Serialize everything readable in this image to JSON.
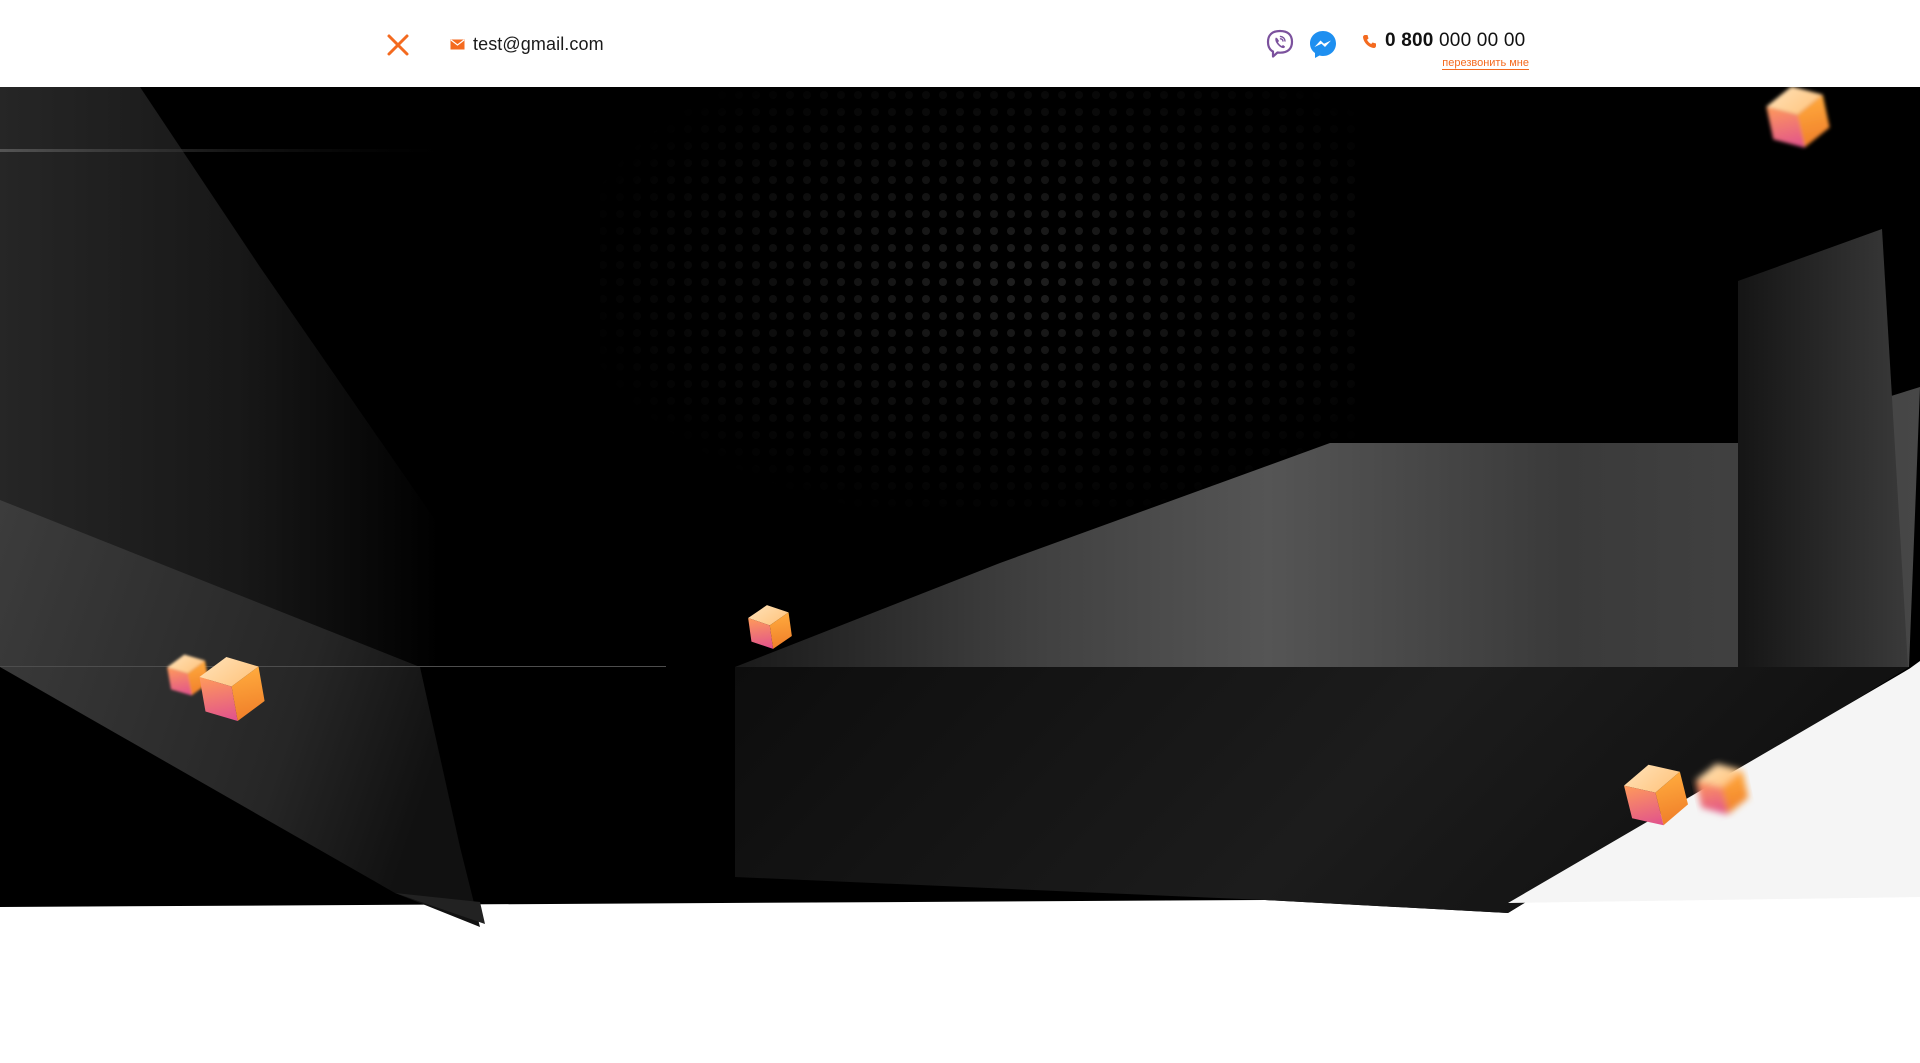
{
  "header": {
    "email": "test@gmail.com",
    "phone_prefix": "0 800",
    "phone_rest": "000 00 00",
    "callback_label": "перезвонить мне"
  },
  "icons": {
    "close": "close-icon",
    "mail": "mail-icon",
    "viber": "viber-icon",
    "messenger": "messenger-icon",
    "phone": "phone-icon",
    "cube": "cube-icon"
  },
  "colors": {
    "accent": "#f46a1f",
    "viber": "#7b519d",
    "messenger": "#1e8ff0",
    "hero_bg": "#000000"
  }
}
